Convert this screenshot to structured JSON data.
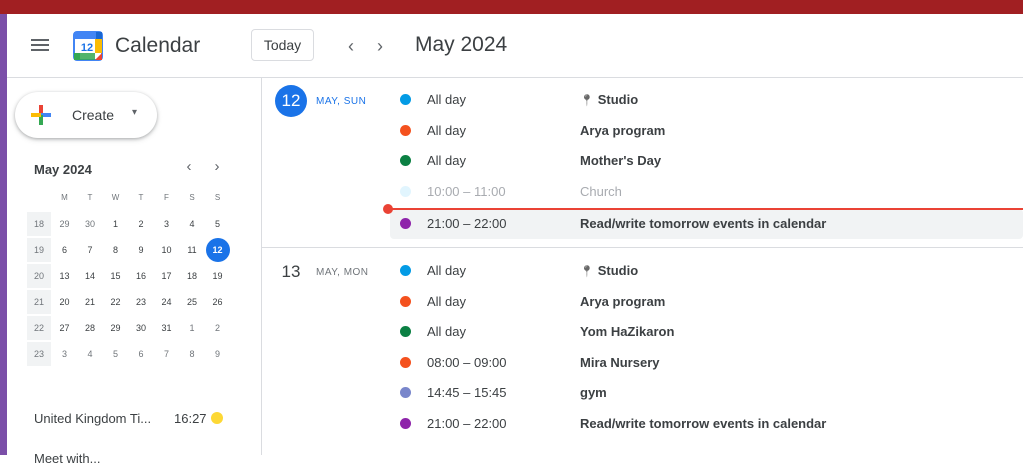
{
  "header": {
    "logo_day": "12",
    "app_title": "Calendar",
    "today_label": "Today",
    "prev_arrow": "‹",
    "next_arrow": "›",
    "current_period": "May 2024"
  },
  "sidebar": {
    "create_label": "Create",
    "create_caret": "▾",
    "mini_calendar": {
      "title": "May 2024",
      "prev_arrow": "‹",
      "next_arrow": "›",
      "weekdays": [
        "M",
        "T",
        "W",
        "T",
        "F",
        "S",
        "S"
      ],
      "weeks": [
        {
          "wk": "18",
          "days": [
            {
              "d": "29",
              "o": true
            },
            {
              "d": "30",
              "o": true
            },
            {
              "d": "1"
            },
            {
              "d": "2"
            },
            {
              "d": "3"
            },
            {
              "d": "4"
            },
            {
              "d": "5"
            }
          ]
        },
        {
          "wk": "19",
          "days": [
            {
              "d": "6"
            },
            {
              "d": "7"
            },
            {
              "d": "8"
            },
            {
              "d": "9"
            },
            {
              "d": "10"
            },
            {
              "d": "11"
            },
            {
              "d": "12",
              "sel": true
            }
          ]
        },
        {
          "wk": "20",
          "days": [
            {
              "d": "13"
            },
            {
              "d": "14"
            },
            {
              "d": "15"
            },
            {
              "d": "16"
            },
            {
              "d": "17"
            },
            {
              "d": "18"
            },
            {
              "d": "19"
            }
          ]
        },
        {
          "wk": "21",
          "days": [
            {
              "d": "20"
            },
            {
              "d": "21"
            },
            {
              "d": "22"
            },
            {
              "d": "23"
            },
            {
              "d": "24"
            },
            {
              "d": "25"
            },
            {
              "d": "26"
            }
          ]
        },
        {
          "wk": "22",
          "days": [
            {
              "d": "27"
            },
            {
              "d": "28"
            },
            {
              "d": "29"
            },
            {
              "d": "30"
            },
            {
              "d": "31"
            },
            {
              "d": "1",
              "o": true
            },
            {
              "d": "2",
              "o": true
            }
          ]
        },
        {
          "wk": "23",
          "days": [
            {
              "d": "3",
              "o": true
            },
            {
              "d": "4",
              "o": true
            },
            {
              "d": "5",
              "o": true
            },
            {
              "d": "6",
              "o": true
            },
            {
              "d": "7",
              "o": true
            },
            {
              "d": "8",
              "o": true
            },
            {
              "d": "9",
              "o": true
            }
          ]
        }
      ]
    },
    "timezone_label": "United Kingdom Ti...",
    "timezone_time": "16:27",
    "meet_label": "Meet with..."
  },
  "agenda": {
    "days": [
      {
        "date_num": "12",
        "date_sub": "MAY, SUN",
        "is_today": true,
        "events": [
          {
            "time": "All day",
            "title": "Studio",
            "location_pin": true,
            "color": "#039be5"
          },
          {
            "time": "All day",
            "title": "Arya program",
            "color": "#f4511e"
          },
          {
            "time": "All day",
            "title": "Mother's Day",
            "color": "#0b8043"
          },
          {
            "time": "10:00 – 11:00",
            "title": "Church",
            "color": "#e1f5fe",
            "past": true
          },
          {
            "time": "21:00 – 22:00",
            "title": "Read/write tomorrow events in calendar",
            "color": "#8e24aa",
            "hover": true
          }
        ]
      },
      {
        "date_num": "13",
        "date_sub": "MAY, MON",
        "is_today": false,
        "events": [
          {
            "time": "All day",
            "title": "Studio",
            "location_pin": true,
            "color": "#039be5"
          },
          {
            "time": "All day",
            "title": "Arya program",
            "color": "#f4511e"
          },
          {
            "time": "All day",
            "title": "Yom HaZikaron",
            "color": "#0b8043"
          },
          {
            "time": "08:00 – 09:00",
            "title": "Mira Nursery",
            "color": "#f4511e"
          },
          {
            "time": "14:45 – 15:45",
            "title": "gym",
            "color": "#7986cb"
          },
          {
            "time": "21:00 – 22:00",
            "title": "Read/write tomorrow events in calendar",
            "color": "#8e24aa"
          }
        ]
      }
    ]
  },
  "colors": {
    "accent": "#1a73e8",
    "now_line": "#ea4335",
    "browser_bar": "#a11f22"
  }
}
